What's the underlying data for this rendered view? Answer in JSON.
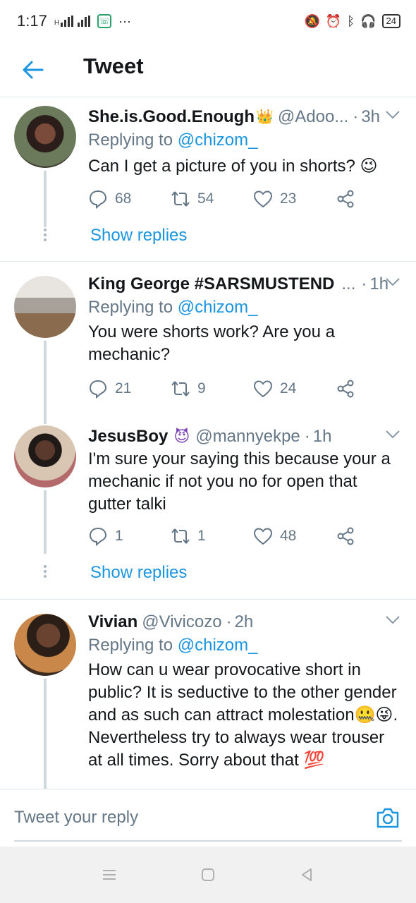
{
  "status_bar": {
    "time": "1:17",
    "net_label": "H",
    "battery": "24"
  },
  "header": {
    "title": "Tweet"
  },
  "tweets": [
    {
      "name": "She.is.Good.Enough",
      "name_badge": "👑",
      "handle": "@Adoo...",
      "time": "3h",
      "replying_prefix": "Replying to",
      "replying_to": "@chizom_",
      "text": "Can I get a picture of you in shorts? 😉",
      "replies": "68",
      "retweets": "54",
      "likes": "23",
      "show_replies": "Show replies"
    },
    {
      "name": "King George #SARSMUSTEND",
      "handle": "...",
      "time": "1h",
      "replying_prefix": "Replying to",
      "replying_to": "@chizom_",
      "text": "You were shorts work? Are you a mechanic?",
      "replies": "21",
      "retweets": "9",
      "likes": "24"
    },
    {
      "name": "JesusBoy",
      "name_badge": "😈",
      "handle": "@mannyekpe",
      "time": "1h",
      "text": "I'm sure your saying this because your a mechanic if not you no for open that gutter talki",
      "replies": "1",
      "retweets": "1",
      "likes": "48",
      "show_replies": "Show replies"
    },
    {
      "name": "Vivian",
      "handle": "@Vivicozo",
      "time": "2h",
      "replying_prefix": "Replying to",
      "replying_to": "@chizom_",
      "text": "How can u wear provocative short in public? It is seductive to the other gender and as such can attract molestation🤐😜. Nevertheless try to always wear trouser at all times. Sorry about that 💯"
    }
  ],
  "reply_bar": {
    "placeholder": "Tweet your reply"
  },
  "colors": {
    "accent": "#1b95e0",
    "muted": "#657786",
    "text": "#14171a",
    "divider": "#e1e8ed"
  }
}
